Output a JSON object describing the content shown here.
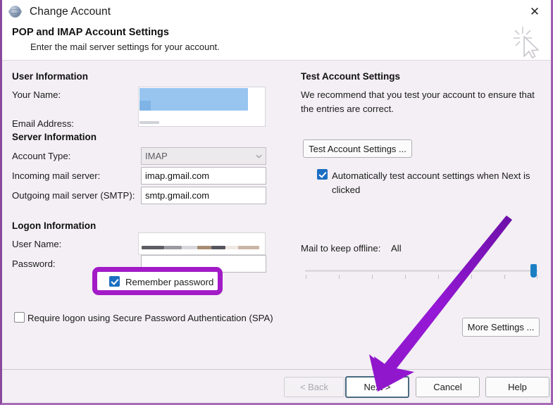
{
  "window": {
    "title": "Change Account",
    "app_icon": "globe-icon",
    "close_icon": "close-icon"
  },
  "header": {
    "title": "POP and IMAP Account Settings",
    "subtitle": "Enter the mail server settings for your account.",
    "decor_icon": "cursor-sparkle-icon"
  },
  "left": {
    "user_information": {
      "heading": "User Information",
      "fields": [
        {
          "label": "Your Name:",
          "value": "",
          "redacted": true
        },
        {
          "label": "Email Address:",
          "value": "",
          "redacted": true
        }
      ]
    },
    "server_information": {
      "heading": "Server Information",
      "account_type": {
        "label": "Account Type:",
        "value": "IMAP",
        "disabled": true
      },
      "incoming": {
        "label": "Incoming mail server:",
        "value": "imap.gmail.com"
      },
      "outgoing": {
        "label": "Outgoing mail server (SMTP):",
        "value": "smtp.gmail.com"
      }
    },
    "logon_information": {
      "heading": "Logon Information",
      "user_name": {
        "label": "User Name:",
        "value": "",
        "redacted": true
      },
      "password": {
        "label": "Password:",
        "value": ""
      },
      "remember_password": {
        "label": "Remember password",
        "checked": true,
        "highlighted": true
      },
      "require_spa": {
        "label": "Require logon using Secure Password Authentication (SPA)",
        "checked": false
      }
    }
  },
  "right": {
    "test_account": {
      "heading": "Test Account Settings",
      "description": "We recommend that you test your account to ensure that the entries are correct.",
      "button_label": "Test Account Settings ...",
      "auto_test": {
        "label": "Automatically test account settings when Next is clicked",
        "checked": true
      }
    },
    "offline": {
      "label": "Mail to keep offline:",
      "value": "All",
      "slider_percent": 100
    },
    "more_settings_label": "More Settings ..."
  },
  "footer": {
    "back_label": "< Back",
    "next_label": "Next >",
    "cancel_label": "Cancel",
    "help_label": "Help"
  },
  "annotations": {
    "highlight_color": "#a21bc7",
    "arrow_color": "#8f17c9",
    "accent_checkbox_color": "#1b6ec2",
    "slider_thumb_color": "#1b7fc4"
  }
}
